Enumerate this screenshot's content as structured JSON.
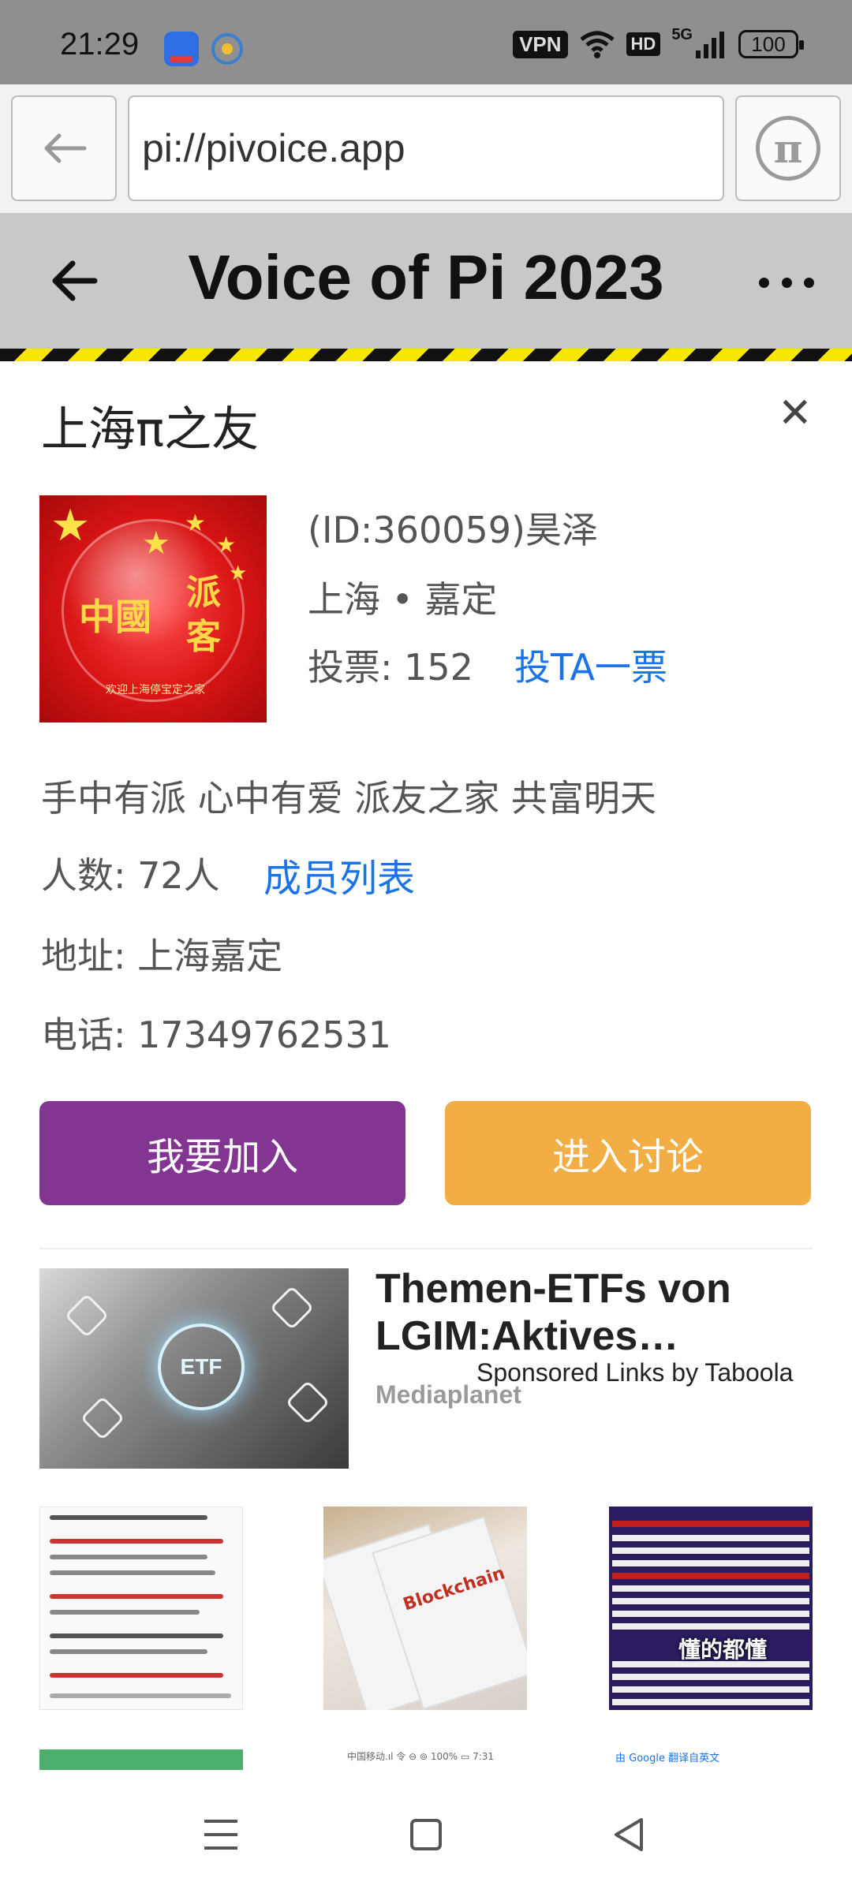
{
  "status_bar": {
    "time": "21:29",
    "vpn": "VPN",
    "hd": "HD",
    "network": "5G",
    "battery": "100"
  },
  "browser": {
    "url": "pi://pivoice.app",
    "pi_symbol": "π"
  },
  "header": {
    "title": "Voice of Pi 2023"
  },
  "group": {
    "name": "上海π之友",
    "close_symbol": "✕",
    "logo_text_left": "中國",
    "logo_text_right": "派客",
    "logo_caption": "欢迎上海停宝定之家",
    "id_line": "(ID:360059)昊泽",
    "location": "上海 • 嘉定",
    "votes_label": "投票: 152",
    "vote_link": "投TA一票",
    "slogan": "手中有派 心中有爱 派友之家 共富明天",
    "members_label": "人数: 72人",
    "members_link": "成员列表",
    "address": "地址: 上海嘉定",
    "phone": "电话: 17349762531",
    "join_button": "我要加入",
    "discuss_button": "进入讨论"
  },
  "ad": {
    "title": "Themen-ETFs von LGIM:Aktives…",
    "sponsor": "Sponsored Links by Taboola",
    "source": "Mediaplanet",
    "image_text": "ETF"
  },
  "thumbnails": {
    "t2_text": "Blockchain",
    "t3_badge": "懂的都懂"
  },
  "peek": {
    "p2": "中国移动.ıl 令   ⊖ ⊚ 100% ▭ 7:31",
    "p3": "由 Google 翻译自英文"
  },
  "colors": {
    "join": "#833592",
    "discuss": "#f2ae44",
    "link": "#1a73e8",
    "header_bg": "#c8c8c8"
  },
  "icons": {
    "back": "arrow-left-icon",
    "more": "more-horizontal-icon",
    "close": "close-icon",
    "pi": "pi-logo-icon",
    "nav_menu": "menu-icon",
    "nav_home": "square-icon",
    "nav_back": "triangle-back-icon"
  }
}
